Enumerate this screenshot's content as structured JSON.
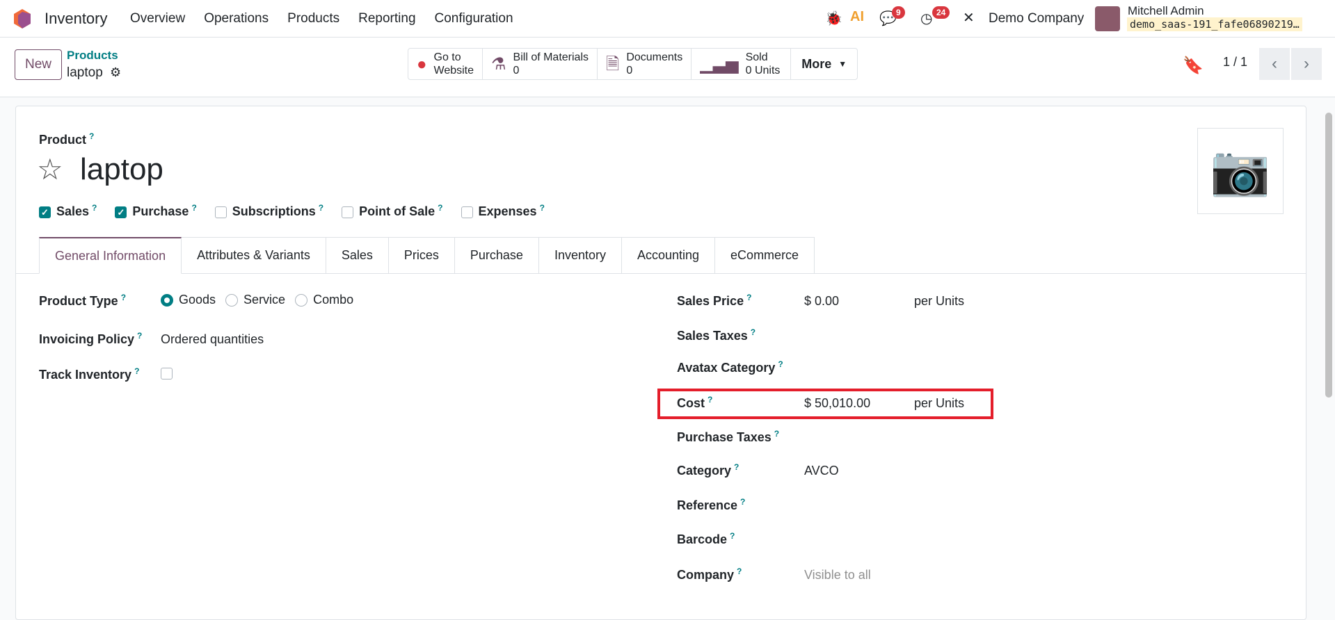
{
  "nav": {
    "app": "Inventory",
    "menu": [
      "Overview",
      "Operations",
      "Products",
      "Reporting",
      "Configuration"
    ],
    "messages_count": "9",
    "activities_count": "24",
    "company": "Demo Company",
    "user": "Mitchell Admin",
    "database": "demo_saas-191_fafe06890219…"
  },
  "control": {
    "new": "New",
    "breadcrumb_parent": "Products",
    "breadcrumb_current": "laptop",
    "stats": [
      {
        "l1": "Go to",
        "l2": "Website"
      },
      {
        "l1": "Bill of Materials",
        "l2": "0"
      },
      {
        "l1": "Documents",
        "l2": "0"
      },
      {
        "l1": "Sold",
        "l2": "0 Units"
      }
    ],
    "more": "More",
    "pager": "1 / 1"
  },
  "form": {
    "product_label": "Product",
    "help": "?",
    "name": "laptop",
    "options": [
      {
        "label": "Sales",
        "checked": true
      },
      {
        "label": "Purchase",
        "checked": true
      },
      {
        "label": "Subscriptions",
        "checked": false
      },
      {
        "label": "Point of Sale",
        "checked": false
      },
      {
        "label": "Expenses",
        "checked": false
      }
    ],
    "tabs": [
      "General Information",
      "Attributes & Variants",
      "Sales",
      "Prices",
      "Purchase",
      "Inventory",
      "Accounting",
      "eCommerce"
    ],
    "left": {
      "product_type_label": "Product Type",
      "types": [
        "Goods",
        "Service",
        "Combo"
      ],
      "selected_type": "Goods",
      "invoicing_label": "Invoicing Policy",
      "invoicing_value": "Ordered quantities",
      "track_label": "Track Inventory"
    },
    "right": [
      {
        "label": "Sales Price",
        "value": "$ 0.00",
        "unit": "per Units"
      },
      {
        "label": "Sales Taxes",
        "value": "",
        "unit": ""
      },
      {
        "label": "Avatax Category",
        "value": "",
        "unit": ""
      },
      {
        "label": "Cost",
        "value": "$ 50,010.00",
        "unit": "per Units"
      },
      {
        "label": "Purchase Taxes",
        "value": "",
        "unit": ""
      },
      {
        "label": "Category",
        "value": "AVCO",
        "unit": ""
      },
      {
        "label": "Reference",
        "value": "",
        "unit": ""
      },
      {
        "label": "Barcode",
        "value": "",
        "unit": ""
      },
      {
        "label": "Company",
        "value": "Visible to all",
        "unit": ""
      }
    ]
  }
}
